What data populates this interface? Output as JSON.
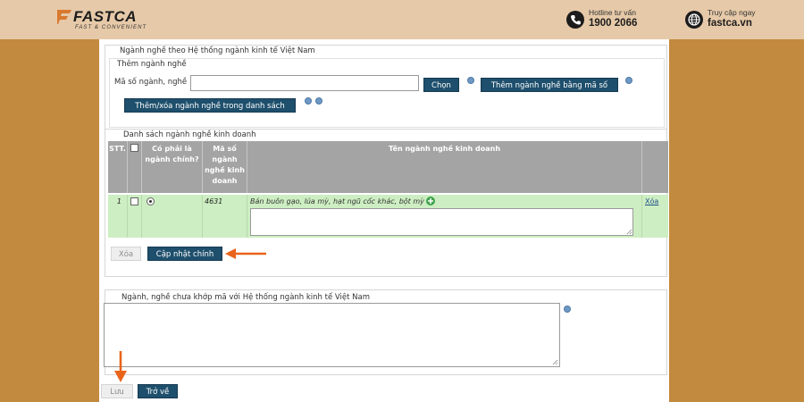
{
  "header": {
    "logo_text": "FASTCA",
    "logo_tagline": "FAST & CONVENIENT",
    "hotline_label": "Hotline tư vấn",
    "hotline_number": "1900 2066",
    "site_label": "Truy cập ngay",
    "site_url": "fastca.vn"
  },
  "form": {
    "section_title": "Ngành nghề theo Hệ thống ngành kinh tế Việt Nam",
    "add_section_title": "Thêm ngành nghề",
    "code_label": "Mã số ngành, nghề",
    "code_input_value": "",
    "choose_button": "Chọn",
    "add_by_code_button": "Thêm ngành nghề bằng mã số",
    "add_remove_list_button": "Thêm/xóa ngành nghề trong danh sách",
    "list_title": "Danh sách ngành nghề kinh doanh",
    "table": {
      "headers": {
        "stt": "STT.",
        "is_main": "Có phải là ngành chính?",
        "code": "Mã số ngành nghề kinh doanh",
        "name": "Tên ngành nghề kinh doanh"
      },
      "rows": [
        {
          "stt": "1",
          "checked": false,
          "is_main": true,
          "code": "4631",
          "name": "Bán buôn gạo, lúa mỳ, hạt ngũ cốc khác, bột mỳ",
          "detail": "",
          "delete_link": "Xóa"
        }
      ]
    },
    "delete_button": "Xóa",
    "update_main_button": "Cập nhật chính",
    "unmatched_title": "Ngành, nghề chưa khớp mã với Hệ thống ngành kinh tế Việt Nam",
    "unmatched_value": "",
    "save_button": "Lưu",
    "back_button": "Trở về"
  },
  "colors": {
    "page_background": "#c28a3e",
    "banner_background": "#e6c9a8",
    "button_primary": "#1e4f6c",
    "table_header": "#a4a4a4",
    "row_highlight": "#cdeec2",
    "annotation_arrow": "#e8641b"
  },
  "icons": [
    "phone-icon",
    "globe-icon",
    "help-icon",
    "add-detail-icon",
    "arrow-left-annotation",
    "arrow-down-annotation"
  ]
}
